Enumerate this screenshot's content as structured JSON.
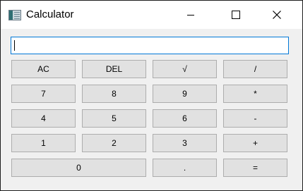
{
  "window": {
    "title": "Calculator"
  },
  "display": {
    "value": ""
  },
  "keys": {
    "ac": "AC",
    "del": "DEL",
    "sqrt": "√",
    "divide": "/",
    "seven": "7",
    "eight": "8",
    "nine": "9",
    "multiply": "*",
    "four": "4",
    "five": "5",
    "six": "6",
    "subtract": "-",
    "one": "1",
    "two": "2",
    "three": "3",
    "add": "+",
    "zero": "0",
    "decimal": ".",
    "equals": "="
  },
  "icons": {
    "app": "calculator-app-icon",
    "minimize": "minimize-icon",
    "maximize": "maximize-icon",
    "close": "close-icon"
  },
  "colors": {
    "window_bg": "#f0f0f0",
    "titlebar_bg": "#ffffff",
    "button_bg": "#e1e1e1",
    "button_border": "#adadad",
    "input_focus_border": "#0078d7"
  }
}
